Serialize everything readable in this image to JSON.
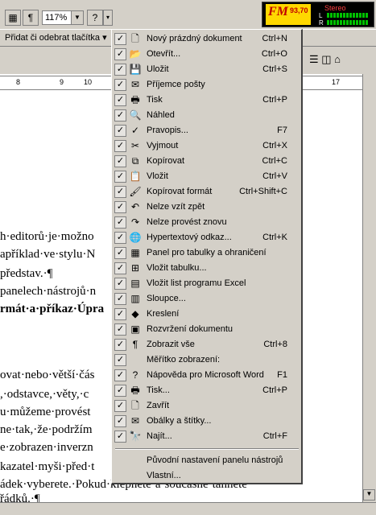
{
  "toolbar": {
    "pilcrow": "¶",
    "zoom": "117%",
    "help_icon": "help-icon",
    "add_remove_label": "Přidat či odebrat tlačítka"
  },
  "radio": {
    "brand": "FM",
    "frequency": "93,70",
    "stereo": "Stereo",
    "left": "L",
    "right": "R"
  },
  "ruler": {
    "marks": [
      "8",
      "9",
      "10",
      "17"
    ]
  },
  "document": {
    "lines": [
      "h·editorů·je·možno",
      "apříklad·ve·stylu·N",
      "představ.·¶",
      "panelech·nástrojů·n",
      "rmát·a·příkaz·Úpra",
      "ovat·nebo·větší·čás",
      ",·odstavce,·věty,·c",
      "u·můžeme·provést",
      "ne·tak,·že·podržím",
      "e·zobrazen·inverzn",
      "kazatel·myši·před·t",
      "ádek·vyberete.·Pokud·klepnete·a·současně·tahnete",
      "řádků.·¶"
    ]
  },
  "menu": {
    "items": [
      {
        "label": "Nový prázdný dokument",
        "shortcut": "Ctrl+N",
        "icon": "new-document-icon",
        "glyph": "🗋"
      },
      {
        "label": "Otevřít...",
        "shortcut": "Ctrl+O",
        "icon": "open-folder-icon",
        "glyph": "📂"
      },
      {
        "label": "Uložit",
        "shortcut": "Ctrl+S",
        "icon": "save-disk-icon",
        "glyph": "💾"
      },
      {
        "label": "Příjemce pošty",
        "shortcut": "",
        "icon": "mail-recipient-icon",
        "glyph": "✉"
      },
      {
        "label": "Tisk",
        "shortcut": "Ctrl+P",
        "icon": "print-icon",
        "glyph": "🖶"
      },
      {
        "label": "Náhled",
        "shortcut": "",
        "icon": "print-preview-icon",
        "glyph": "🔍"
      },
      {
        "label": "Pravopis...",
        "shortcut": "F7",
        "icon": "spelling-icon",
        "glyph": "✓"
      },
      {
        "label": "Vyjmout",
        "shortcut": "Ctrl+X",
        "icon": "cut-scissors-icon",
        "glyph": "✂"
      },
      {
        "label": "Kopírovat",
        "shortcut": "Ctrl+C",
        "icon": "copy-icon",
        "glyph": "⧉"
      },
      {
        "label": "Vložit",
        "shortcut": "Ctrl+V",
        "icon": "paste-icon",
        "glyph": "📋"
      },
      {
        "label": "Kopírovat formát",
        "shortcut": "Ctrl+Shift+C",
        "icon": "format-painter-icon",
        "glyph": "🖌"
      },
      {
        "label": "Nelze vzít zpět",
        "shortcut": "",
        "icon": "undo-icon",
        "glyph": "↶"
      },
      {
        "label": "Nelze provést znovu",
        "shortcut": "",
        "icon": "redo-icon",
        "glyph": "↷"
      },
      {
        "label": "Hypertextový odkaz...",
        "shortcut": "Ctrl+K",
        "icon": "hyperlink-globe-icon",
        "glyph": "🌐"
      },
      {
        "label": "Panel pro tabulky a ohraničení",
        "shortcut": "",
        "icon": "tables-borders-icon",
        "glyph": "▦"
      },
      {
        "label": "Vložit tabulku...",
        "shortcut": "",
        "icon": "insert-table-icon",
        "glyph": "⊞"
      },
      {
        "label": "Vložit list programu Excel",
        "shortcut": "",
        "icon": "insert-excel-icon",
        "glyph": "▤"
      },
      {
        "label": "Sloupce...",
        "shortcut": "",
        "icon": "columns-icon",
        "glyph": "▥"
      },
      {
        "label": "Kreslení",
        "shortcut": "",
        "icon": "drawing-icon",
        "glyph": "◆"
      },
      {
        "label": "Rozvržení dokumentu",
        "shortcut": "",
        "icon": "document-map-icon",
        "glyph": "▣"
      },
      {
        "label": "Zobrazit vše",
        "shortcut": "Ctrl+8",
        "icon": "show-all-pilcrow-icon",
        "glyph": "¶"
      },
      {
        "label": "Měřítko zobrazení:",
        "shortcut": "",
        "icon": "",
        "glyph": ""
      },
      {
        "label": "Nápověda pro Microsoft Word",
        "shortcut": "F1",
        "icon": "help-icon",
        "glyph": "?"
      },
      {
        "label": "Tisk...",
        "shortcut": "Ctrl+P",
        "icon": "print-icon",
        "glyph": "🖶"
      },
      {
        "label": "Zavřít",
        "shortcut": "",
        "icon": "close-document-icon",
        "glyph": "🗋"
      },
      {
        "label": "Obálky a štítky...",
        "shortcut": "",
        "icon": "envelope-icon",
        "glyph": "✉"
      },
      {
        "label": "Najít...",
        "shortcut": "Ctrl+F",
        "icon": "find-binoculars-icon",
        "glyph": "🔭"
      }
    ],
    "reset_label": "Původní nastavení panelu nástrojů",
    "custom_label": "Vlastní..."
  }
}
